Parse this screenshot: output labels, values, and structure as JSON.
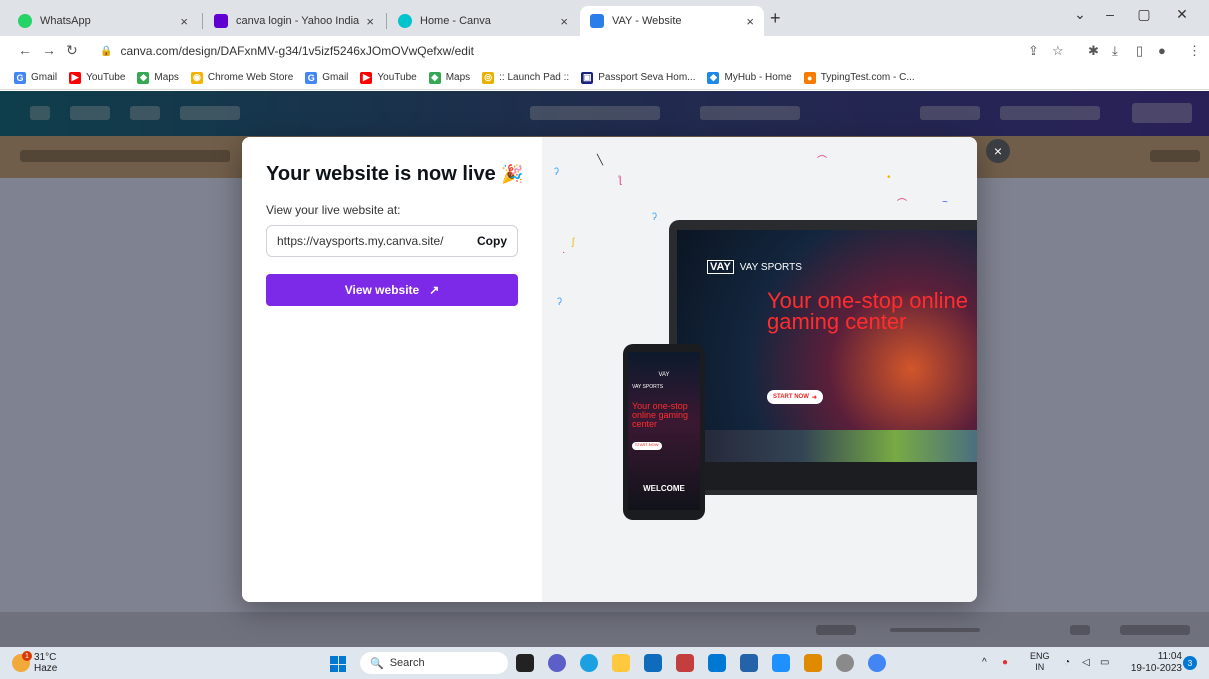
{
  "browser": {
    "tabs": [
      {
        "title": "WhatsApp",
        "color": "#25d366"
      },
      {
        "title": "canva login - Yahoo India Search",
        "color": "#6001d2"
      },
      {
        "title": "Home - Canva",
        "color": "#00c4cc"
      },
      {
        "title": "VAY - Website",
        "color": "#2b7de9"
      }
    ],
    "new_tab": "+",
    "url": "canva.com/design/DAFxnMV-g34/1v5izf5246xJOmOVwQefxw/edit"
  },
  "bookmarks": [
    {
      "label": "Gmail",
      "icon": "G",
      "color": "#4285f4"
    },
    {
      "label": "YouTube",
      "icon": "▶",
      "color": "#ff0000"
    },
    {
      "label": "Maps",
      "icon": "◆",
      "color": "#34a853"
    },
    {
      "label": "Chrome Web Store",
      "icon": "◉",
      "color": "#f4b400"
    },
    {
      "label": "Gmail",
      "icon": "G",
      "color": "#4285f4"
    },
    {
      "label": "YouTube",
      "icon": "▶",
      "color": "#ff0000"
    },
    {
      "label": "Maps",
      "icon": "◆",
      "color": "#34a853"
    },
    {
      "label": ":: Launch Pad ::",
      "icon": "◎",
      "color": "#e8b100"
    },
    {
      "label": "Passport Seva Hom...",
      "icon": "▣",
      "color": "#1a237e"
    },
    {
      "label": "MyHub - Home",
      "icon": "◆",
      "color": "#1e88e5"
    },
    {
      "label": "TypingTest.com - C...",
      "icon": "●",
      "color": "#f57c00"
    }
  ],
  "modal": {
    "title": "Your website is now live",
    "title_emoji": "🎉",
    "subtitle": "View your live website at:",
    "site_url": "https://vaysports.my.canva.site/",
    "copy_label": "Copy",
    "view_button": "View website",
    "view_button_icon": "↗",
    "close": "×"
  },
  "preview": {
    "brand_logo": "VAY",
    "brand_name": "VAY SPORTS",
    "hero": "Your one-stop online gaming center",
    "start_button": "START NOW",
    "welcome": "WELCOME"
  },
  "taskbar": {
    "temp": "31°C",
    "condition": "Haze",
    "weather_badge": "1",
    "search": "Search",
    "lang_top": "ENG",
    "lang_bottom": "IN",
    "time": "11:04",
    "date": "19-10-2023",
    "notif_count": "3"
  }
}
